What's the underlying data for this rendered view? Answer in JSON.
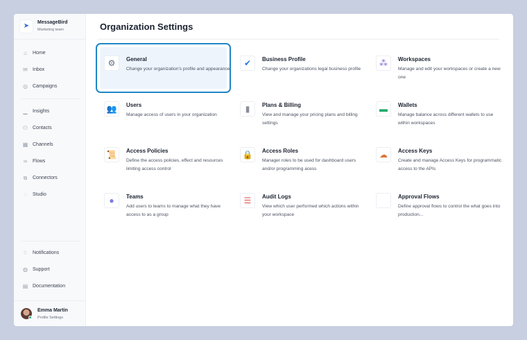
{
  "brand": {
    "name": "MessageBird",
    "team": "Marketing team"
  },
  "nav_top": [
    {
      "label": "Home",
      "icon": "home-icon"
    },
    {
      "label": "Inbox",
      "icon": "inbox-icon"
    },
    {
      "label": "Campaigns",
      "icon": "campaigns-icon"
    }
  ],
  "nav_mid": [
    {
      "label": "Insights",
      "icon": "insights-icon"
    },
    {
      "label": "Contacts",
      "icon": "contacts-icon"
    },
    {
      "label": "Channels",
      "icon": "channels-icon"
    },
    {
      "label": "Flows",
      "icon": "flows-icon"
    },
    {
      "label": "Connectors",
      "icon": "connectors-icon"
    },
    {
      "label": "Studio",
      "icon": "studio-icon"
    }
  ],
  "nav_bottom": [
    {
      "label": "Notifications",
      "icon": "bell-icon"
    },
    {
      "label": "Support",
      "icon": "support-icon"
    },
    {
      "label": "Documentation",
      "icon": "documentation-icon"
    }
  ],
  "user": {
    "name": "Emma Martin",
    "sub": "Profile Settings"
  },
  "page": {
    "title": "Organization Settings"
  },
  "cards": [
    {
      "title": "General",
      "desc": "Change your organization's profile and appearance",
      "icon": "gear-icon",
      "selected": true
    },
    {
      "title": "Business Profile",
      "desc": "Change your organizations legal business profile",
      "icon": "verified-badge-icon"
    },
    {
      "title": "Workspaces",
      "desc": "Manage and edit your workspaces or create a new one",
      "icon": "workspaces-icon"
    },
    {
      "title": "Users",
      "desc": "Manage access of users in your organization",
      "icon": "users-icon"
    },
    {
      "title": "Plans & Billing",
      "desc": "View and manage your pricing plans and billing settings",
      "icon": "billing-icon"
    },
    {
      "title": "Wallets",
      "desc": "Manage balance across different wallets to use within workspaces",
      "icon": "wallet-icon"
    },
    {
      "title": "Access Policies",
      "desc": "Define the access policies, effect and resources limiting access control",
      "icon": "policy-scroll-icon"
    },
    {
      "title": "Access Roles",
      "desc": "Manager roles to be used for dashboard users and/or programming acess",
      "icon": "lock-icon"
    },
    {
      "title": "Access Keys",
      "desc": "Create and manage Access Keys for programmatic access to the APIs",
      "icon": "cloud-key-icon"
    },
    {
      "title": "Teams",
      "desc": "Add users to teams to manage what they have access to as a group",
      "icon": "teams-icon"
    },
    {
      "title": "Audit Logs",
      "desc": "View which user performed which actions within your workspace",
      "icon": "audit-list-icon"
    },
    {
      "title": "Approval Flows",
      "desc": "Define approval flows to control the what goes into production...",
      "icon": "approval-flows-icon"
    }
  ]
}
